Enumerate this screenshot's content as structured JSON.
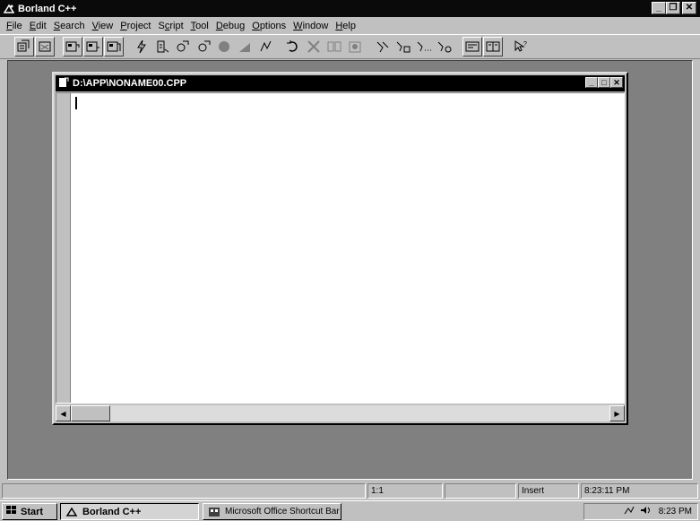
{
  "app": {
    "title": "Borland C++"
  },
  "menu": {
    "items": [
      {
        "label": "File",
        "u": "F",
        "rest": "ile"
      },
      {
        "label": "Edit",
        "u": "E",
        "rest": "dit"
      },
      {
        "label": "Search",
        "u": "S",
        "rest": "earch"
      },
      {
        "label": "View",
        "u": "V",
        "rest": "iew"
      },
      {
        "label": "Project",
        "u": "P",
        "rest": "roject"
      },
      {
        "label": "Script",
        "pre": "S",
        "u": "c",
        "rest": "ript"
      },
      {
        "label": "Tool",
        "u": "T",
        "rest": "ool"
      },
      {
        "label": "Debug",
        "u": "D",
        "rest": "ebug"
      },
      {
        "label": "Options",
        "u": "O",
        "rest": "ptions"
      },
      {
        "label": "Window",
        "u": "W",
        "rest": "indow"
      },
      {
        "label": "Help",
        "u": "H",
        "rest": "elp"
      }
    ]
  },
  "editor": {
    "title": "D:\\APP\\NONAME00.CPP",
    "content": ""
  },
  "status": {
    "position": "1:1",
    "mode": "Insert",
    "clock": "8:23:11 PM"
  },
  "taskbar": {
    "start_label": "Start",
    "tasks": [
      "Borland C++",
      "Microsoft Office Shortcut Bar"
    ],
    "time": "8:23 PM"
  },
  "colors": {
    "face": "#c0c0c0",
    "title_bg": "#000000",
    "mdi_bg": "#808080",
    "editor_bg": "#ffffff"
  }
}
